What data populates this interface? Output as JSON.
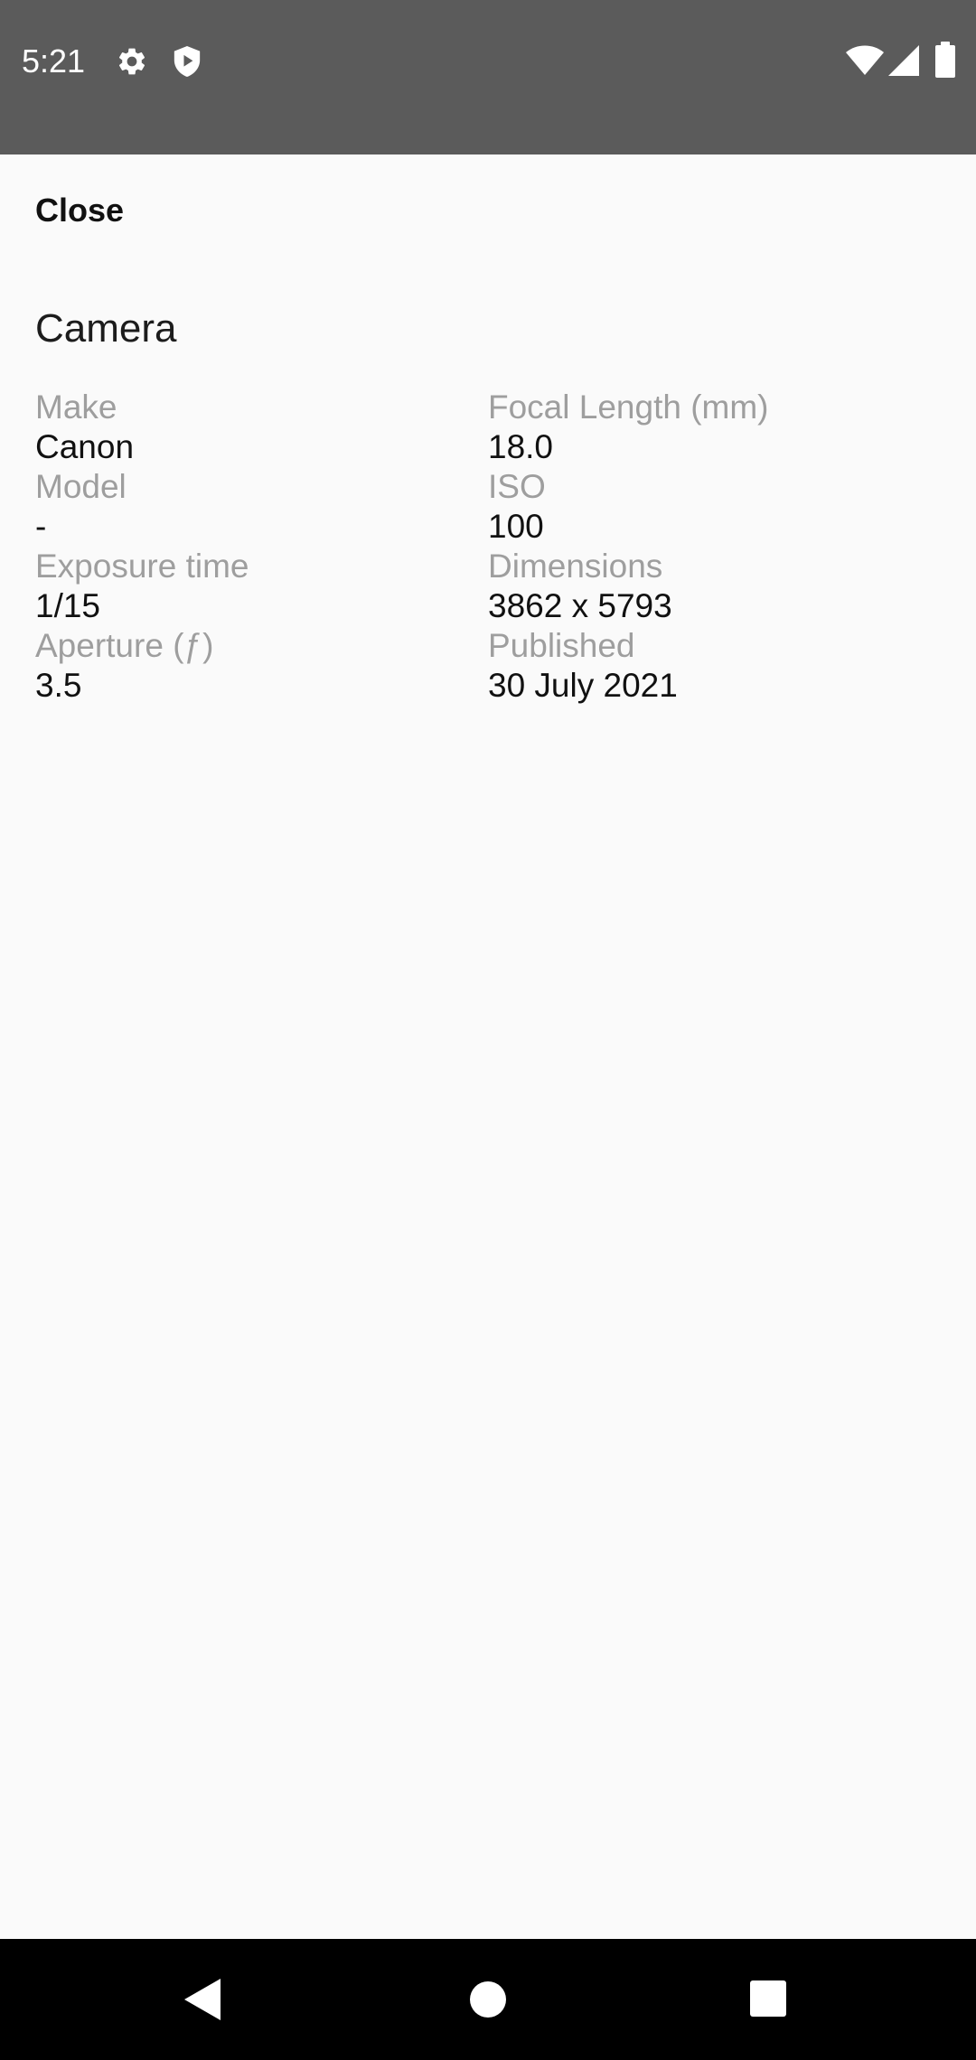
{
  "status_bar": {
    "time": "5:21",
    "icons": [
      "gear-icon",
      "shield-icon",
      "wifi-icon",
      "signal-icon",
      "battery-icon"
    ]
  },
  "header": {
    "close_label": "Close"
  },
  "section": {
    "title": "Camera"
  },
  "left_fields": [
    {
      "label": "Make",
      "value": "Canon"
    },
    {
      "label": "Model",
      "value": "-"
    },
    {
      "label": "Exposure time",
      "value": "1/15"
    },
    {
      "label": "Aperture (ƒ)",
      "value": "3.5"
    }
  ],
  "right_fields": [
    {
      "label": "Focal Length (mm)",
      "value": "18.0"
    },
    {
      "label": "ISO",
      "value": "100"
    },
    {
      "label": "Dimensions",
      "value": "3862 x 5793"
    },
    {
      "label": "Published",
      "value": "30 July 2021"
    }
  ],
  "nav_bar": {
    "icons": [
      "back-icon",
      "home-icon",
      "recents-icon"
    ]
  },
  "colors": {
    "status_bar_bg": "#5b5b5b",
    "background": "#fafafa",
    "label_gray": "#9e9e9e",
    "text_dark": "#111111",
    "nav_bar_bg": "#000000"
  }
}
